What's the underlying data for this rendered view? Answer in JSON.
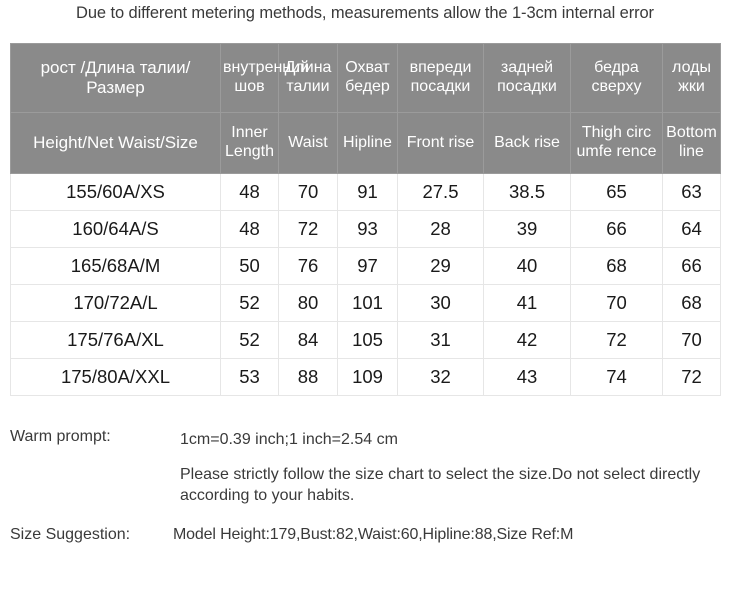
{
  "notice": "Due to different metering methods, measurements allow the 1-3cm internal error",
  "table": {
    "headers_ru": [
      "рост /Длина талии/Размер",
      "внутренний шов",
      "Длина талии",
      "Охват бедер",
      "впереди посадки",
      "задней посадки",
      "бедра сверху",
      "лоды жки"
    ],
    "headers_en": [
      "Height/Net Waist/Size",
      "Inner Length",
      "Waist",
      "Hipline",
      "Front rise",
      "Back rise",
      "Thigh circ umfe rence",
      "Bottom line"
    ],
    "rows": [
      [
        "155/60A/XS",
        "48",
        "70",
        "91",
        "27.5",
        "38.5",
        "65",
        "63"
      ],
      [
        "160/64A/S",
        "48",
        "72",
        "93",
        "28",
        "39",
        "66",
        "64"
      ],
      [
        "165/68A/M",
        "50",
        "76",
        "97",
        "29",
        "40",
        "68",
        "66"
      ],
      [
        "170/72A/L",
        "52",
        "80",
        "101",
        "30",
        "41",
        "70",
        "68"
      ],
      [
        "175/76A/XL",
        "52",
        "84",
        "105",
        "31",
        "42",
        "72",
        "70"
      ],
      [
        "175/80A/XXL",
        "53",
        "88",
        "109",
        "32",
        "43",
        "74",
        "72"
      ]
    ]
  },
  "notes": {
    "warm_prompt_label": "Warm prompt:",
    "warm_prompt_line1": "1cm=0.39 inch;1 inch=2.54 cm",
    "warm_prompt_line2": "Please strictly follow the size chart  to select the size.Do not select directly according to your habits.",
    "size_suggestion_label": "Size Suggestion:",
    "size_suggestion_value": "Model Height:179,Bust:82,Waist:60,Hipline:88,Size Ref:M"
  },
  "colors": {
    "header_bg": "#8a8a8a",
    "header_text": "#ffffff",
    "body_bg": "#ffffff",
    "body_text": "#1a1a1a",
    "grid_line": "#e6e6e6",
    "page_bg": "#ffffff"
  }
}
